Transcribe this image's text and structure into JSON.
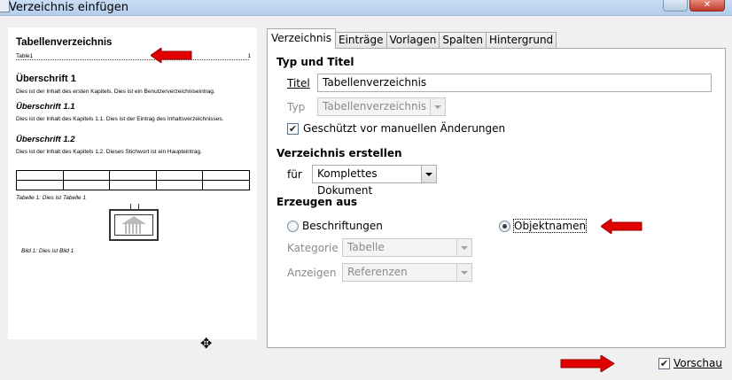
{
  "window": {
    "title": "Verzeichnis einfügen",
    "close_label": "✕"
  },
  "preview": {
    "heading": "Tabellenverzeichnis",
    "entry": {
      "text": "Table1",
      "page": "1"
    },
    "chapter": "Überschrift 1",
    "chapter_text": "Dies ist der Inhalt des ersten Kapitels. Dies ist ein Benutzerverzeichniseintrag.",
    "sub1": "Überschrift 1.1",
    "sub1_text": "Dies ist der Inhalt des Kapitels 1.1. Dies ist der Eintrag des Inhaltsverzeichnisses.",
    "sub2": "Überschrift 1.2",
    "sub2_text": "Dies ist der Inhalt des Kapitels 1.2. Dieses Stichwort ist ein Haupteintrag.",
    "table_caption": "Tabelle 1: Dies ist Tabelle 1",
    "image_caption": "Bild 1: Dies ist Bild 1"
  },
  "tabs": [
    "Verzeichnis",
    "Einträge",
    "Vorlagen",
    "Spalten",
    "Hintergrund"
  ],
  "type_title": {
    "section": "Typ und Titel",
    "title_label": "Titel",
    "title_value": "Tabellenverzeichnis",
    "type_label": "Typ",
    "type_value": "Tabellenverzeichnis",
    "protected_label": "Geschützt vor manuellen Änderungen",
    "protected_checked": true
  },
  "create": {
    "section": "Verzeichnis erstellen",
    "for_label": "für",
    "for_value": "Komplettes Dokument"
  },
  "generate": {
    "section": "Erzeugen aus",
    "captions_label": "Beschriftungen",
    "objects_label": "Objektnamen",
    "selected": "Objektnamen",
    "category_label": "Kategorie",
    "category_value": "Tabelle",
    "display_label": "Anzeigen",
    "display_value": "Referenzen"
  },
  "footer": {
    "preview_label": "Vorschau",
    "preview_checked": true
  },
  "colors": {
    "arrow": "#e00000",
    "window_bg": "#f0f0f0"
  },
  "icons": [
    "move-cursor-icon",
    "close-icon",
    "minimize-icon",
    "arrow-pointer-icon"
  ]
}
